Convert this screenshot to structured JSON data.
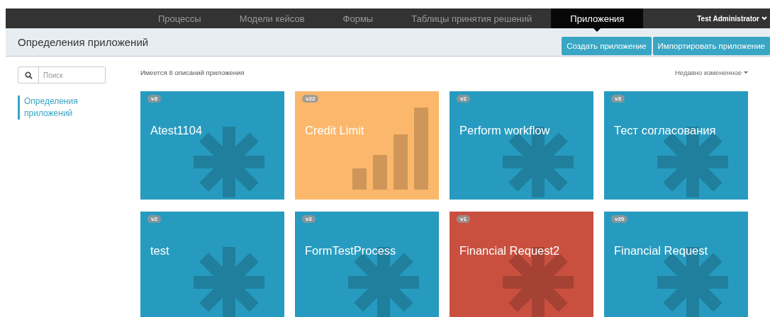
{
  "navbar": {
    "tabs": [
      {
        "label": "Процессы",
        "selected": false
      },
      {
        "label": "Модели кейсов",
        "selected": false
      },
      {
        "label": "Формы",
        "selected": false
      },
      {
        "label": "Таблицы принятия решений",
        "selected": false
      },
      {
        "label": "Приложения",
        "selected": true
      }
    ],
    "user": "Test Administrator"
  },
  "header": {
    "title": "Определения приложений",
    "buttons": [
      "Создать приложение",
      "Импортировать приложение"
    ]
  },
  "search": {
    "placeholder": "Поиск"
  },
  "sidebar": {
    "items": [
      {
        "label": "Определения приложений",
        "selected": true
      }
    ]
  },
  "summary": "Имеется 8 описаний приложения",
  "sort": "Недавно измененное",
  "apps": [
    {
      "name": "Atest1104",
      "version": "v3",
      "kind": "asterisk",
      "color": "#279bbf"
    },
    {
      "name": "Credit Limit",
      "version": "v22",
      "kind": "chart",
      "color": "#fbb86c"
    },
    {
      "name": "Perform workflow",
      "version": "v2",
      "kind": "asterisk",
      "color": "#279bbf"
    },
    {
      "name": "Тест согласования",
      "version": "v3",
      "kind": "asterisk",
      "color": "#279bbf"
    },
    {
      "name": "test",
      "version": "v2",
      "kind": "asterisk",
      "color": "#279bbf"
    },
    {
      "name": "FormTestProcess",
      "version": "v2",
      "kind": "asterisk",
      "color": "#279bbf"
    },
    {
      "name": "Financial Request2",
      "version": "v1",
      "kind": "asterisk",
      "color": "#c9503f"
    },
    {
      "name": "Financial Request",
      "version": "v20",
      "kind": "asterisk",
      "color": "#279bbf"
    }
  ]
}
